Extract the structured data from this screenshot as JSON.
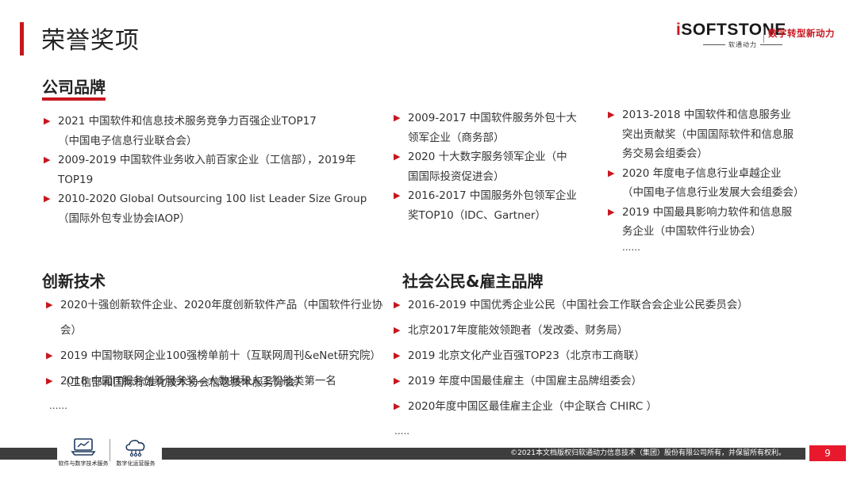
{
  "page": {
    "title": "荣誉奖项",
    "number": "9"
  },
  "logo": {
    "main_prefix": "i",
    "main_rest": "SOFTSTONE",
    "sub": "软通动力",
    "slogan": "数字转型新动力"
  },
  "sections": {
    "brand": {
      "title": "公司品牌",
      "col1": [
        {
          "text": "2021 中国软件和信息技术服务竞争力百强企业TOP17",
          "sub": "（中国电子信息行业联合会）"
        },
        {
          "text": "2009-2019 中国软件业务收入前百家企业（工信部），2019年",
          "sub": "TOP19"
        },
        {
          "text": "2010-2020 Global Outsourcing 100 list Leader Size Group",
          "sub": "（国际外包专业协会IAOP）"
        }
      ],
      "col2": [
        {
          "text": "2009-2017 中国软件服务外包十大",
          "sub": "领军企业（商务部）"
        },
        {
          "text": "2020 十大数字服务领军企业（中",
          "sub": "国国际投资促进会）"
        },
        {
          "text": "2016-2017 中国服务外包领军企业",
          "sub": "奖TOP10（IDC、Gartner）"
        }
      ],
      "col3": [
        {
          "text": "2013-2018 中国软件和信息服务业",
          "sub": "突出贡献奖（中国国际软件和信息服",
          "sub2": "务交易会组委会）"
        },
        {
          "text": "2020 年度电子信息行业卓越企业",
          "sub": "（中国电子信息行业发展大会组委会）"
        },
        {
          "text": "2019 中国最具影响力软件和信息服",
          "sub": "务企业（中国软件行业协会）"
        }
      ],
      "ellipsis": "......"
    },
    "innovation": {
      "title": "创新技术",
      "items": [
        "2020十强创新软件企业、2020年度创新软件产品（中国软件行业协会）",
        "2019 中国物联网企业100强榜单前十（互联网周刊&eNet研究院）",
        "2018 中国IT服务创新服务奖—大数据和人工智能类第一名"
      ],
      "note": "（工信部和国际标准化技术协会信息技术服务分会）",
      "ellipsis": "......"
    },
    "citizen": {
      "title": "社会公民&雇主品牌",
      "items": [
        "2016-2019 中国优秀企业公民（中国社会工作联合会企业公民委员会）",
        "北京2017年度能效领跑者（发改委、财务局）",
        "2019 北京文化产业百强TOP23（北京市工商联）",
        "2019 年度中国最佳雇主（中国雇主品牌组委会）",
        "2020年度中国区最佳雇主企业（中企联合 CHIRC ）"
      ],
      "ellipsis": "....."
    }
  },
  "footer": {
    "copyright": "©2021本文档版权归软通动力信息技术（集团）股份有限公司所有，并保留所有权利。",
    "icon1_label": "软件与数字技术服务",
    "icon2_label": "数字化运营服务"
  },
  "colors": {
    "accent": "#c8161d",
    "page_badge": "#e8192c",
    "footer_bar": "#3d3d3d"
  }
}
